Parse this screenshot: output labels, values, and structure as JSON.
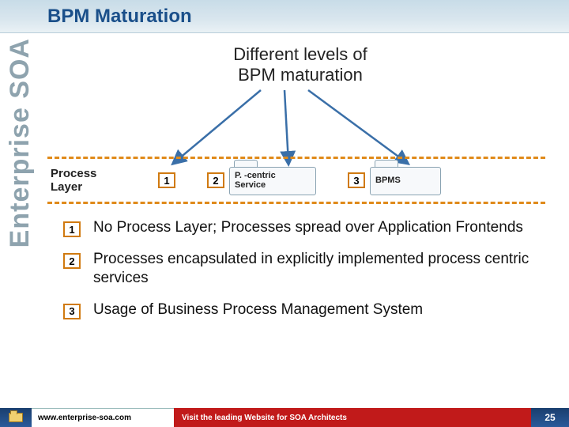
{
  "header": {
    "title": "BPM Maturation"
  },
  "side_label": "Enterprise SOA",
  "subtitle_line1": "Different levels of",
  "subtitle_line2": "BPM maturation",
  "process_row": {
    "label": "Process\nLayer",
    "levels": [
      {
        "num": "1",
        "folder": null
      },
      {
        "num": "2",
        "folder": "P. -centric\nService"
      },
      {
        "num": "3",
        "folder": "BPMS"
      }
    ]
  },
  "descriptions": [
    {
      "num": "1",
      "text": "No Process Layer; Processes spread over Application Frontends"
    },
    {
      "num": "2",
      "text": "Processes encapsulated in explicitly implemented process centric services"
    },
    {
      "num": "3",
      "text": "Usage of Business Process Management System"
    }
  ],
  "footer": {
    "url": "www.enterprise-soa.com",
    "cta": "Visit the leading Website for SOA Architects",
    "page": "25"
  }
}
